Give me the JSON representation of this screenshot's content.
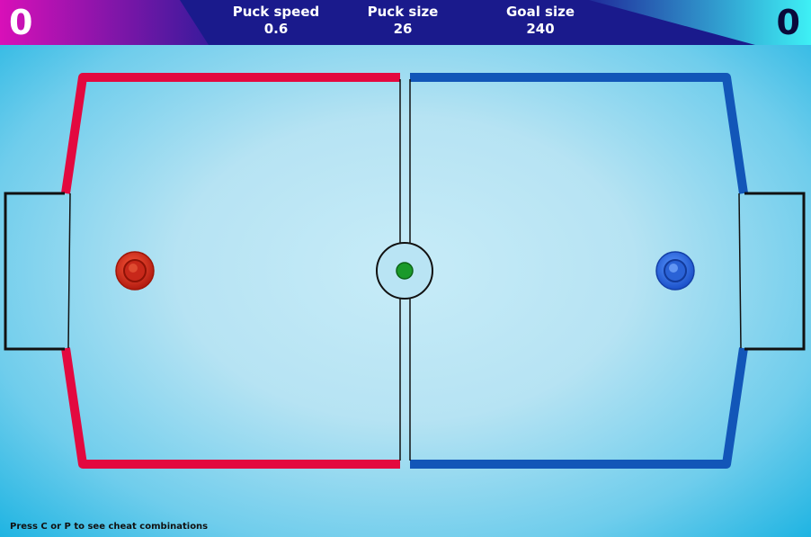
{
  "scores": {
    "red": "0",
    "blue": "0"
  },
  "stats": [
    {
      "label": "Puck speed",
      "value": "0.6"
    },
    {
      "label": "Puck size",
      "value": "26"
    },
    {
      "label": "Goal size",
      "value": "240"
    }
  ],
  "hint": "Press C or P to see cheat combinations",
  "colors": {
    "red_team": "#e3093f",
    "blue_team": "#1256b8",
    "header_navy": "#1a1a8c",
    "red_corner": "#d418b0",
    "blue_corner": "#38e6f2",
    "puck": "#1a9a2a"
  },
  "objects": {
    "red_mallet": "red-mallet",
    "blue_mallet": "blue-mallet",
    "puck": "green-puck"
  }
}
